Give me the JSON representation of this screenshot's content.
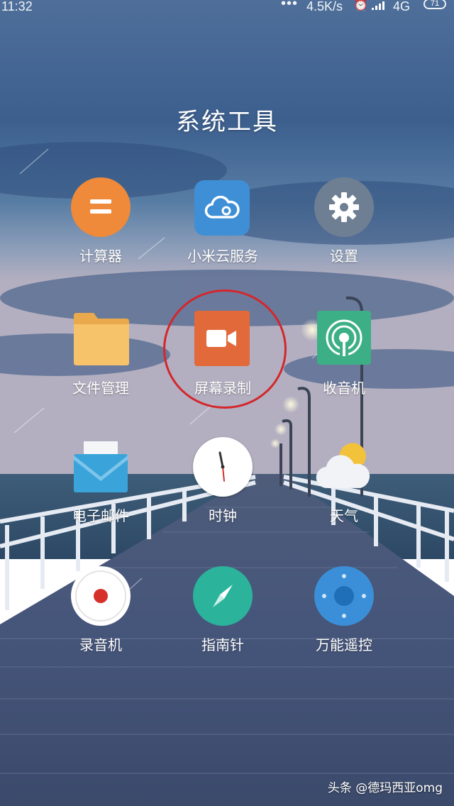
{
  "status_bar": {
    "time": "11:32",
    "dots": "•••",
    "net_speed": "4.5K/s",
    "network_type": "4G",
    "battery_level": "71"
  },
  "folder": {
    "title": "系统工具"
  },
  "apps": [
    {
      "label": "计算器",
      "icon": "calculator-icon",
      "color": "#ee8a3a"
    },
    {
      "label": "小米云服务",
      "icon": "cloud-icon",
      "color": "#3f8fd6"
    },
    {
      "label": "设置",
      "icon": "gear-icon",
      "color": "#6f7f93"
    },
    {
      "label": "文件管理",
      "icon": "folder-icon",
      "color": "#f4b85c"
    },
    {
      "label": "屏幕录制",
      "icon": "video-camera-icon",
      "color": "#e2693a"
    },
    {
      "label": "收音机",
      "icon": "radio-icon",
      "color": "#3caf86"
    },
    {
      "label": "电子邮件",
      "icon": "envelope-icon",
      "color": "#3aa3d9"
    },
    {
      "label": "时钟",
      "icon": "clock-icon",
      "color": "#ffffff"
    },
    {
      "label": "天气",
      "icon": "weather-sun-cloud-icon",
      "color": "#f2c23b"
    },
    {
      "label": "录音机",
      "icon": "recorder-icon",
      "color": "#d6302b"
    },
    {
      "label": "指南针",
      "icon": "compass-icon",
      "color": "#2bb39c"
    },
    {
      "label": "万能遥控",
      "icon": "remote-control-icon",
      "color": "#3b8fd8"
    }
  ],
  "watermark": "头条 @德玛西亚omg"
}
